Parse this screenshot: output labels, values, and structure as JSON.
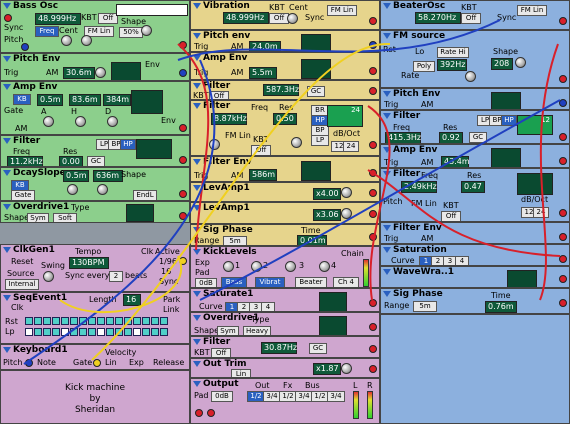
{
  "modules": {
    "bass_osc": {
      "title": "Bass Osc",
      "freq": "48.999Hz",
      "kbt_label": "KBT",
      "kbt_value": "Off",
      "sync": "Sync",
      "freq_btn": "Freq",
      "cent": "Cent",
      "fm_lin": "FM Lin",
      "pitch": "Pitch",
      "shape": "Shape",
      "shape_value": "50%"
    },
    "pitch_env_g": {
      "title": "Pitch Env",
      "trig": "Trig",
      "am": "AM",
      "value": "30.6m",
      "env": "Env"
    },
    "amp_env_g": {
      "title": "Amp Env",
      "kb": "KB",
      "t1": "0.5m",
      "t2": "83.6m",
      "t3": "384m",
      "gate": "Gate",
      "a": "A",
      "h": "H",
      "d": "D",
      "am": "AM",
      "env": "Env"
    },
    "filter_g": {
      "title": "Filter",
      "freq": "Freq",
      "value": "11.2kHz",
      "res": "Res",
      "res_value": "0.00",
      "gc": "GC",
      "lp": "LP",
      "bp": "BP",
      "hp": "HP",
      "br": "BR"
    },
    "dcay_slope": {
      "title": "DcaySlope",
      "t1": "0.5m",
      "t2": "636m",
      "kb": "KB",
      "gate": "Gate",
      "shape": "Shape",
      "endl": "EndL"
    },
    "overdrive1_g": {
      "title": "Overdrive1",
      "type": "Type",
      "shape": "Shape",
      "sym": "Sym",
      "soft": "Soft"
    },
    "vibration": {
      "title": "Vibration",
      "freq": "48.999Hz",
      "kbt": "KBT",
      "kbt_value": "Off",
      "sync": "Sync",
      "fm_lin": "FM Lin",
      "cent": "Cent"
    },
    "pitch_env_y": {
      "title": "Pitch env",
      "trig": "Trig",
      "am": "AM",
      "value": "24.0m"
    },
    "amp_env_y": {
      "title": "Amp Env",
      "trig": "Trig",
      "am": "AM",
      "value": "5.5m"
    },
    "filter_y1": {
      "title": "Filter",
      "pitch": "Pitch",
      "kbt": "KBT",
      "kbt_value": "Off",
      "value": "587.3Hz",
      "gc": "GC"
    },
    "filter_y2": {
      "title": "Filter",
      "freq": "Freq",
      "value": "8.87kHz",
      "res": "Res",
      "res_value": "0.50",
      "fm_lin": "FM Lin",
      "kbt": "KBT",
      "kbt_value": "Off",
      "br": "BR",
      "hp": "HP",
      "bp": "BP",
      "lp": "LP",
      "db_oct": "dB/Oct",
      "db12": "12",
      "db24": "24",
      "scope": "24"
    },
    "filter_env": {
      "title": "Filter Env",
      "trig": "Trig",
      "am": "AM",
      "value": "586m"
    },
    "lev_amp1a": {
      "title": "LevAmp1",
      "value": "x4.00"
    },
    "lev_amp1b": {
      "title": "LevAmp1",
      "value": "x3.06"
    },
    "sig_phase_y": {
      "title": "Sig Phase",
      "time": "Time",
      "range": "Range",
      "range_value": "5m",
      "value": "0.01m"
    },
    "beater_osc": {
      "title": "BeaterOsc",
      "freq": "58.270Hz",
      "kbt": "KBT",
      "kbt_value": "Off",
      "sync": "Sync",
      "fm_lin": "FM Lin"
    },
    "fm_source": {
      "title": "FM source",
      "rst": "Rst",
      "lo": "Lo",
      "rate_hi": "Rate Hi",
      "rate": "Rate",
      "value": "392Hz",
      "shape": "Shape",
      "shape_value": "208",
      "poly": "Poly"
    },
    "pitch_env_b": {
      "title": "Pitch Env",
      "trig": "Trig",
      "am": "AM"
    },
    "filter_b1": {
      "title": "Filter",
      "freq": "Freq",
      "value": "415.3Hz",
      "res": "Res",
      "res_value": "0.92",
      "lp": "LP",
      "bp": "BP",
      "hp": "HP",
      "gc": "GC",
      "scope": "12"
    },
    "amp_env_b": {
      "title": "Amp Env",
      "trig": "Trig",
      "am": "AM",
      "value": "43.4m"
    },
    "filter_b2": {
      "title": "Filter",
      "freq": "Freq",
      "value": "2.49kHz",
      "res": "Res",
      "res_value": "0.47",
      "pitch": "Pitch",
      "fm_lin": "FM Lin",
      "kbt": "KBT",
      "kbt_value": "Off",
      "db_oct": "dB/Oct",
      "db12": "12",
      "db24": "24"
    },
    "filter_env_b": {
      "title": "Filter Env",
      "trig": "Trig",
      "am": "AM"
    },
    "saturation": {
      "title": "Saturation",
      "curve": "Curve",
      "c1": "1",
      "c2": "2",
      "c3": "3",
      "c4": "4"
    },
    "wavewra": {
      "title": "WaveWra..1"
    },
    "sig_phase_b": {
      "title": "Sig Phase",
      "range": "Range",
      "range_value": "5m",
      "time": "Time",
      "value": "0.76m"
    },
    "clkgen": {
      "title": "ClkGen1",
      "reset": "Reset",
      "tempo": "Tempo",
      "tempo_value": "130BPM",
      "clk": "Clk",
      "active": "Active",
      "swing": "Swing",
      "source": "Source",
      "source_value": "Internal",
      "sync_every": "Sync every",
      "sync_value": "2",
      "beats": "beats",
      "r1": "1/96",
      "r2": "16",
      "r3": "Sync"
    },
    "seqevent": {
      "title": "SeqEvent1",
      "clk": "Clk",
      "rst": "Rst",
      "lp": "Lp",
      "length": "Length",
      "length_value": "16",
      "park": "Park",
      "link": "Link"
    },
    "keyboard": {
      "title": "Keyboard1",
      "pitch": "Pitch",
      "note": "Note",
      "gate": "Gate",
      "lin": "Lin",
      "exp": "Exp",
      "release": "Release",
      "velocity": "Velocity"
    },
    "kick_levels": {
      "title": "KickLevels",
      "exp": "Exp",
      "pad": "Pad",
      "pad_value": "0dB",
      "chain": "Chain",
      "bass": "Bass",
      "vibrat": "Vibrat",
      "beater": "Beater",
      "ch4": "Ch 4",
      "n1": "1",
      "n2": "2",
      "n3": "3",
      "n4": "4"
    },
    "saturate1": {
      "title": "Saturate1",
      "curve": "Curve",
      "c1": "1",
      "c2": "2",
      "c3": "3",
      "c4": "4"
    },
    "overdrive1_p": {
      "title": "Overdrive1",
      "type": "Type",
      "shape": "Shape",
      "sym": "Sym",
      "heavy": "Heavy"
    },
    "filter_p": {
      "title": "Filter",
      "kbt": "KBT",
      "kbt_value": "Off",
      "value": "30.87Hz",
      "gc": "GC"
    },
    "out_trim": {
      "title": "Out Trim",
      "lin": "Lin",
      "value": "x1.87"
    },
    "output": {
      "title": "Output",
      "pad": "Pad",
      "pad_value": "0dB",
      "out": "Out",
      "fx": "Fx",
      "bus": "Bus",
      "o1": "1/2",
      "o2": "3/4",
      "fx1": "1/2",
      "fx2": "3/4",
      "b1": "1/2",
      "b2": "3/4",
      "l": "L",
      "r": "R"
    }
  },
  "credit": {
    "l1": "Kick machine",
    "l2": "by",
    "l3": "Sheridan"
  },
  "colors": {
    "green": "#8ccf8c",
    "yellow": "#e6d48c",
    "blue": "#8cb0de",
    "purple": "#cfa6cf",
    "cable_red": "#d8202a",
    "cable_blue": "#2040c0",
    "cable_yellow": "#f0d020"
  }
}
